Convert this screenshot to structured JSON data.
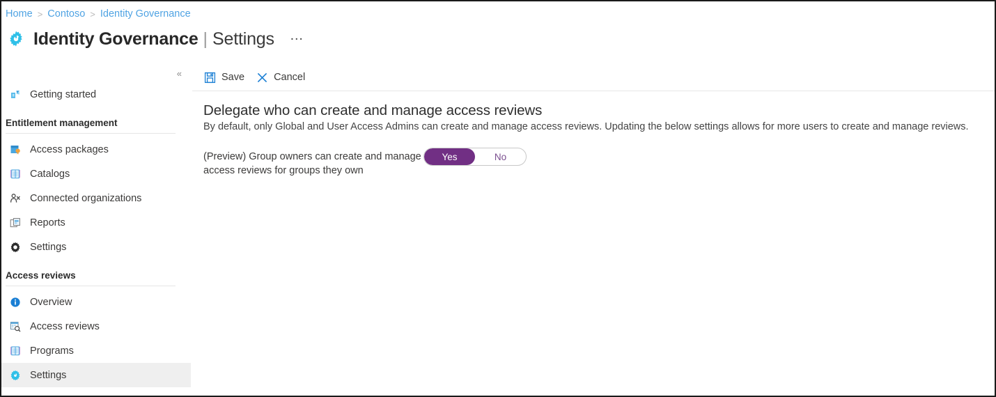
{
  "breadcrumb": {
    "separator": ">",
    "items": [
      {
        "label": "Home"
      },
      {
        "label": "Contoso"
      },
      {
        "label": "Identity Governance"
      }
    ]
  },
  "header": {
    "icon": "identity-governance-gear-icon",
    "title": "Identity Governance",
    "pipe": "|",
    "subtitle": "Settings",
    "more_label": "…"
  },
  "sidebar": {
    "collapse_label": "«",
    "top_items": [
      {
        "label": "Getting started",
        "icon": "getting-started-icon",
        "selected": false
      }
    ],
    "sections": [
      {
        "heading": "Entitlement management",
        "items": [
          {
            "label": "Access packages",
            "icon": "access-packages-icon",
            "selected": false
          },
          {
            "label": "Catalogs",
            "icon": "catalogs-book-icon",
            "selected": false
          },
          {
            "label": "Connected organizations",
            "icon": "connected-organizations-person-icon",
            "selected": false
          },
          {
            "label": "Reports",
            "icon": "reports-documents-icon",
            "selected": false
          },
          {
            "label": "Settings",
            "icon": "settings-gear-icon",
            "selected": false
          }
        ]
      },
      {
        "heading": "Access reviews",
        "items": [
          {
            "label": "Overview",
            "icon": "overview-info-icon",
            "selected": false
          },
          {
            "label": "Access reviews",
            "icon": "access-reviews-search-icon",
            "selected": false
          },
          {
            "label": "Programs",
            "icon": "programs-book-icon",
            "selected": false
          },
          {
            "label": "Settings",
            "icon": "settings-gear-blue-icon",
            "selected": true
          }
        ]
      }
    ]
  },
  "toolbar": {
    "save_label": "Save",
    "save_icon": "save-floppy-icon",
    "cancel_label": "Cancel",
    "cancel_icon": "cancel-x-icon"
  },
  "panel": {
    "title": "Delegate who can create and manage access reviews",
    "description": "By default, only Global and User Access Admins can create and manage access reviews. Updating the below settings allows for more users to create and manage reviews.",
    "setting": {
      "label_line1": "(Preview) Group owners can create and manage",
      "label_line2": "access reviews for groups they own",
      "toggle": {
        "yes_label": "Yes",
        "no_label": "No",
        "value": "Yes"
      }
    }
  },
  "colors": {
    "breadcrumb_link": "#4fa3e3",
    "accent_cyan": "#2fc0e8",
    "toggle_selected": "#712f84",
    "toggle_text_off": "#7a4e8f",
    "selected_row": "#efefef",
    "toolbar_icon_blue": "#1a7fd4"
  }
}
